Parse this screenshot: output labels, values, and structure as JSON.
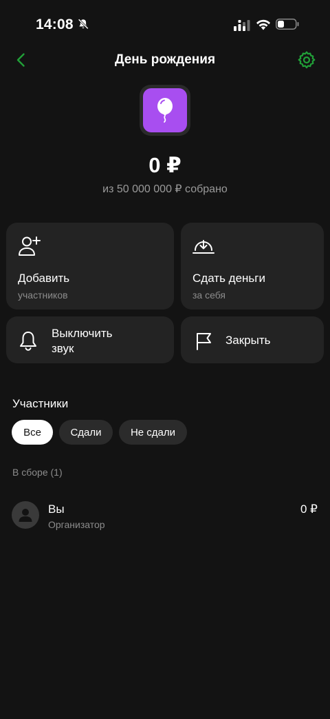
{
  "status": {
    "time": "14:08",
    "icons": [
      "bell-off-icon",
      "signal-icon",
      "wifi-icon",
      "battery-icon"
    ]
  },
  "header": {
    "title": "День рождения",
    "back_icon": "chevron-left-icon",
    "settings_icon": "gear-icon"
  },
  "goal": {
    "icon": "balloon-icon",
    "amount": "0 ₽",
    "subtitle": "из 50 000 000 ₽ собрано"
  },
  "actions": [
    {
      "label": "Добавить",
      "sub": "участников",
      "icon": "add-user-icon"
    },
    {
      "label": "Сдать деньги",
      "sub": "за себя",
      "icon": "download-icon"
    },
    {
      "label": "Выключить звук",
      "label_line1": "Выключить",
      "label_line2": "звук",
      "icon": "bell-icon"
    },
    {
      "label": "Закрыть",
      "icon": "flag-icon"
    }
  ],
  "participants": {
    "title": "Участники",
    "filters": [
      {
        "label": "Все",
        "active": true
      },
      {
        "label": "Сдали",
        "active": false
      },
      {
        "label": "Не сдали",
        "active": false
      }
    ],
    "group_label": "В сборе (1)",
    "members": [
      {
        "name": "Вы",
        "role": "Организатор",
        "amount": "0 ₽",
        "avatar": "person-icon"
      }
    ]
  },
  "colors": {
    "background": "#131313",
    "card": "#232323",
    "accent_green": "#21a038",
    "goal_purple": "#a84ef0"
  }
}
